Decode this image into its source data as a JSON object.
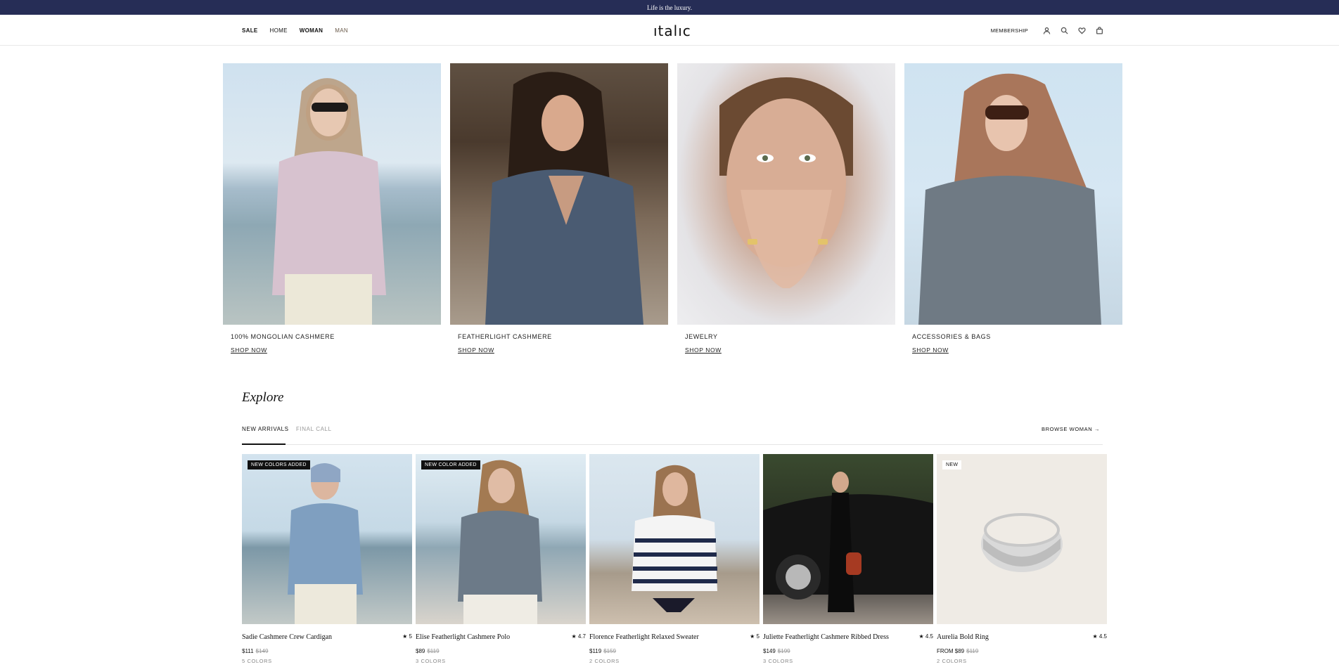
{
  "announcement": "Life is the luxury.",
  "nav": {
    "left": [
      {
        "label": "SALE"
      },
      {
        "label": "HOME"
      },
      {
        "label": "WOMAN"
      },
      {
        "label": "MAN"
      }
    ],
    "logo": "ıtalıc",
    "membership": "MEMBERSHIP",
    "icons": [
      "account-icon",
      "search-icon",
      "heart-icon",
      "bag-icon"
    ]
  },
  "categories": [
    {
      "caption": "100% MONGOLIAN CASHMERE",
      "cta": "SHOP NOW"
    },
    {
      "caption": "FEATHERLIGHT CASHMERE",
      "cta": "SHOP NOW"
    },
    {
      "caption": "JEWELRY",
      "cta": "SHOP NOW"
    },
    {
      "caption": "ACCESSORIES & BAGS",
      "cta": "SHOP NOW"
    }
  ],
  "explore": {
    "title": "Explore",
    "tabs": [
      {
        "label": "NEW ARRIVALS",
        "active": true
      },
      {
        "label": "FINAL CALL",
        "active": false
      }
    ],
    "browse": "BROWSE WOMAN →"
  },
  "products": [
    {
      "badge": "NEW COLORS ADDED",
      "name": "Sadie Cashmere Crew Cardigan",
      "rating": "★ 5",
      "price": "$111",
      "old_price": "$149",
      "colors": "5 COLORS"
    },
    {
      "badge": "NEW COLOR ADDED",
      "name": "Elise Featherlight Cashmere Polo",
      "rating": "★ 4.7",
      "price": "$89",
      "old_price": "$119",
      "colors": "3 COLORS"
    },
    {
      "badge": "",
      "name": "Florence Featherlight Relaxed Sweater",
      "rating": "★ 5",
      "price": "$119",
      "old_price": "$159",
      "colors": "2 COLORS"
    },
    {
      "badge": "",
      "name": "Juliette Featherlight Cashmere Ribbed Dress",
      "rating": "★ 4.5",
      "price": "$149",
      "old_price": "$199",
      "colors": "3 COLORS"
    },
    {
      "badge": "NEW",
      "name": "Aurelia Bold Ring",
      "rating": "★ 4.5",
      "price": "FROM $89",
      "old_price": "$119",
      "colors": "2 COLORS"
    }
  ]
}
